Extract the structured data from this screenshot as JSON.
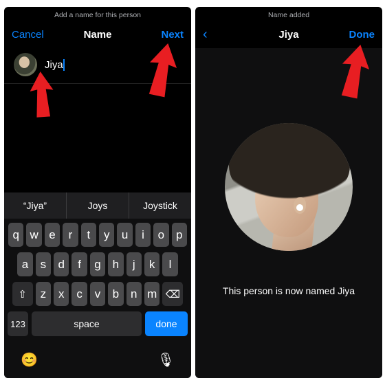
{
  "colors": {
    "accent": "#0a84ff",
    "arrow": "#e81e22"
  },
  "left": {
    "status": "Add a name for this person",
    "nav": {
      "cancel": "Cancel",
      "title": "Name",
      "next": "Next"
    },
    "input": {
      "value": "Jiya"
    },
    "suggestions": [
      "“Jiya”",
      "Joys",
      "Joystick"
    ],
    "keys": {
      "row1": [
        "q",
        "w",
        "e",
        "r",
        "t",
        "y",
        "u",
        "i",
        "o",
        "p"
      ],
      "row2": [
        "a",
        "s",
        "d",
        "f",
        "g",
        "h",
        "j",
        "k",
        "l"
      ],
      "row3": [
        "z",
        "x",
        "c",
        "v",
        "b",
        "n",
        "m"
      ],
      "shift": "⇧",
      "backspace": "⌫",
      "numbers": "123",
      "space": "space",
      "done": "done",
      "emoji": "😊",
      "mic": "🎙"
    }
  },
  "right": {
    "status": "Name added",
    "nav": {
      "back": "‹",
      "title": "Jiya",
      "done": "Done"
    },
    "message": "This person is now named Jiya"
  }
}
